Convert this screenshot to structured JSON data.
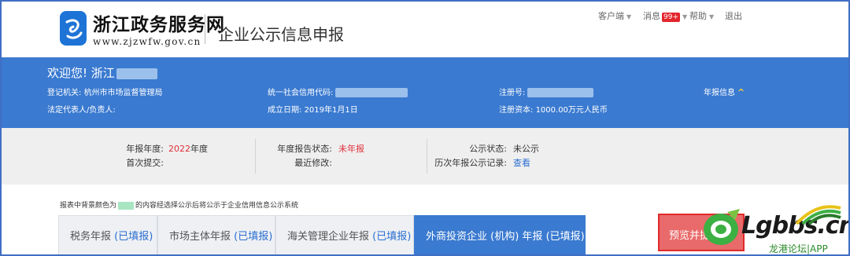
{
  "header": {
    "site_name": "浙江政务服务网",
    "site_url": "www.zjzwfw.gov.cn",
    "page_title": "企业公示信息申报"
  },
  "top_nav": {
    "client": "客户端",
    "messages": "消息",
    "messages_badge": "99+",
    "help": "帮助",
    "logout": "退出"
  },
  "company": {
    "welcome": "欢迎您! 浙江",
    "registration_authority_label": "登记机关:",
    "registration_authority": "杭州市市场监督管理局",
    "legal_rep_label": "法定代表人/负责人:",
    "credit_code_label": "统一社会信用代码:",
    "established_label": "成立日期:",
    "established": "2019年1月1日",
    "reg_no_label": "注册号:",
    "capital_label": "注册资本:",
    "capital": "1000.00万元人民币",
    "annual_info_toggle": "年报信息"
  },
  "report": {
    "year_label": "年报年度:",
    "year_value": "2022",
    "year_suffix": "年度",
    "first_submit_label": "首次提交:",
    "status_label": "年度报告状态:",
    "status_value": "未年报",
    "last_modified_label": "最近修改:",
    "publicity_label": "公示状态:",
    "publicity_value": "未公示",
    "history_label": "历次年报公示记录:",
    "history_link": "查看"
  },
  "notice": {
    "before": "报表中背景颜色为",
    "after": "的内容经选择公示后将公示于企业信用信息公示系统"
  },
  "tabs": [
    {
      "label": "税务年报",
      "status": "(已填报)"
    },
    {
      "label": "市场主体年报",
      "status": "(已填报)"
    },
    {
      "label": "海关管理企业年报",
      "status": "(已填报)"
    },
    {
      "label": "外商投资企业 (机构) 年报",
      "status": "(已填报)"
    }
  ],
  "actions": {
    "preview": "预览并提"
  },
  "watermark": {
    "brand": "Lgbbs.cn",
    "sub": "龙港论坛|APP"
  },
  "colors": {
    "brand_blue": "#3a7ad0",
    "status_red": "#e0303a",
    "link_blue": "#2b6fd1",
    "publicity_swatch": "#a8e6c2"
  }
}
